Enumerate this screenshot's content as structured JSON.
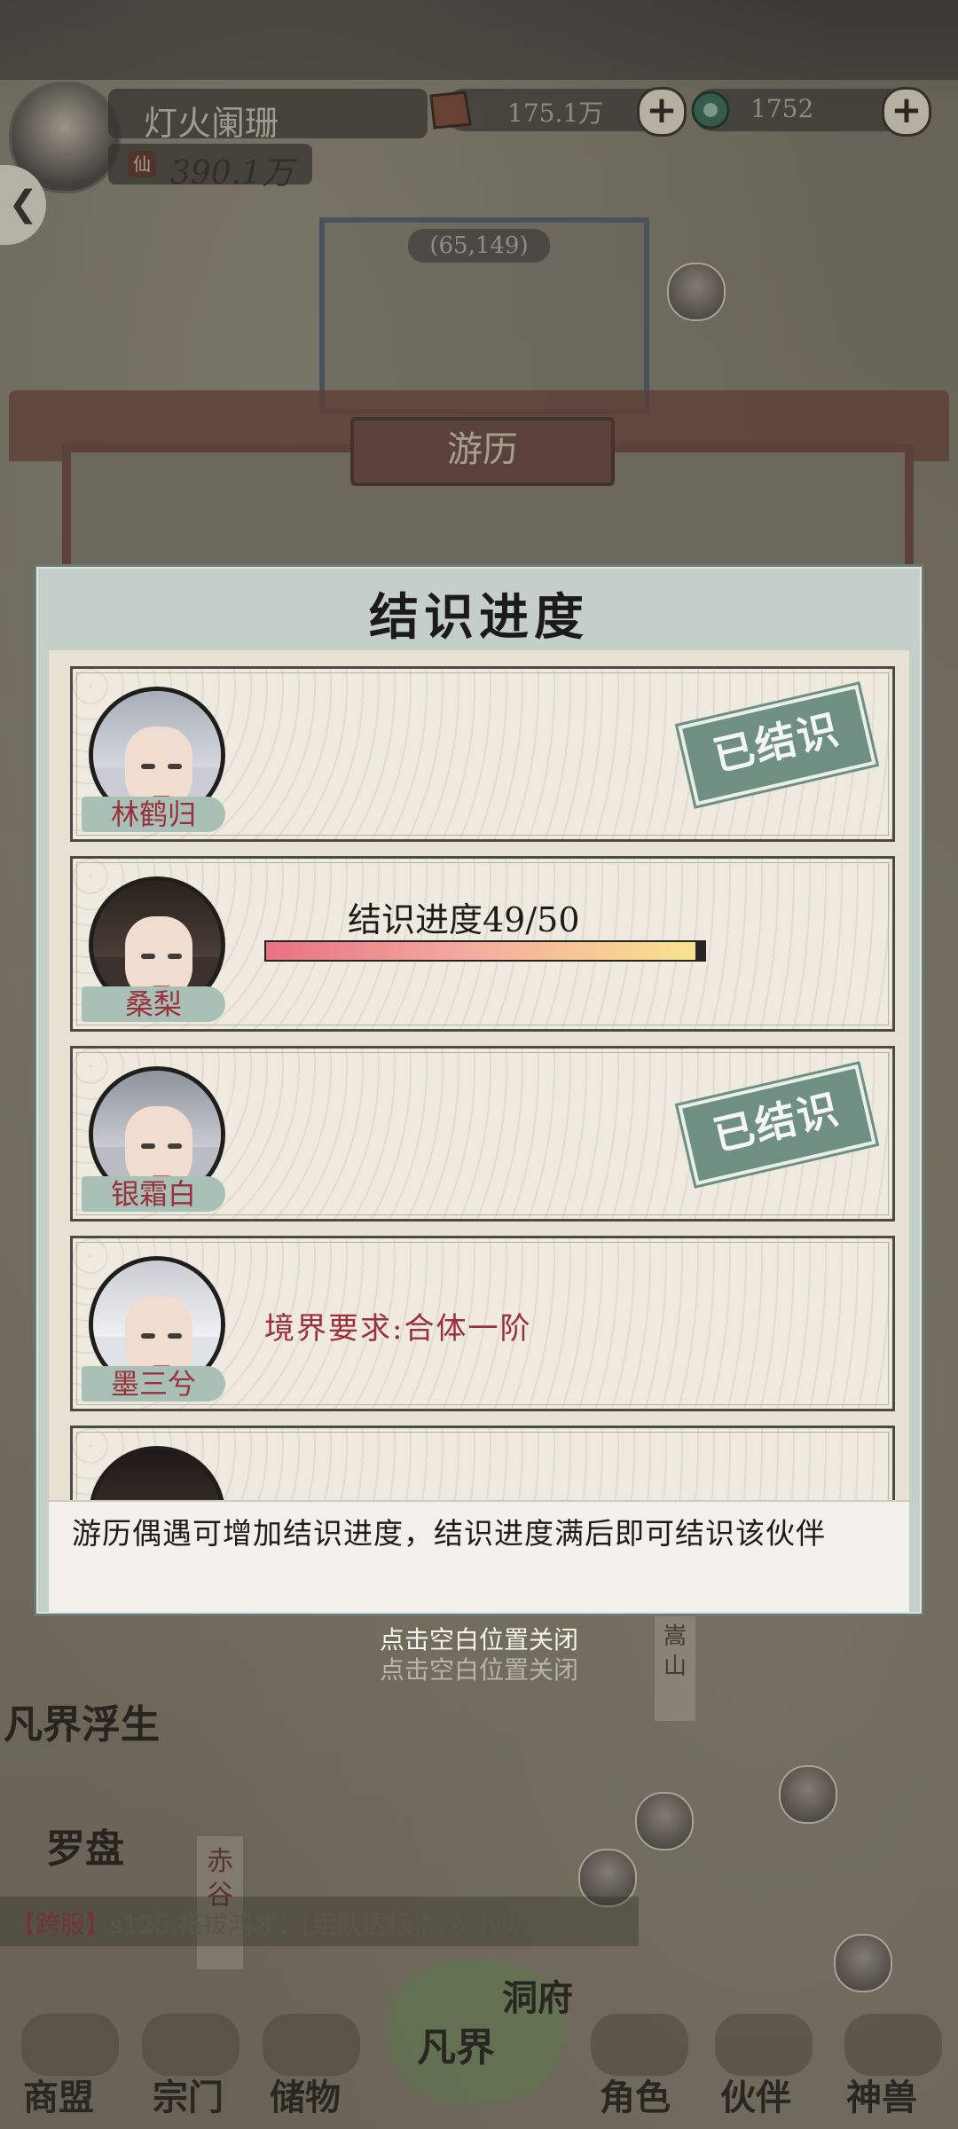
{
  "player": {
    "name": "灯火阑珊",
    "power": "390.1万"
  },
  "currencies": [
    {
      "icon": "ore-icon",
      "value": "175.1万"
    },
    {
      "icon": "jade-icon",
      "value": "1752"
    }
  ],
  "map": {
    "coordinate": "(65,149)"
  },
  "scene": {
    "plaque": "游历",
    "songshan": "嵩山",
    "chigu": "赤谷"
  },
  "modal": {
    "title": "结识进度",
    "companions": [
      {
        "name": "林鹤归",
        "status": "known",
        "stamp": "已结识"
      },
      {
        "name": "桑梨",
        "status": "progress",
        "progress_label": "结识进度49/50",
        "progress_current": 49,
        "progress_max": 50
      },
      {
        "name": "银霜白",
        "status": "known",
        "stamp": "已结识"
      },
      {
        "name": "墨三兮",
        "status": "locked",
        "requirement": "境界要求:合体一阶"
      }
    ],
    "note": "游历偶遇可增加结识进度，结识进度满后即可结识该伙伴",
    "close_hint": "点击空白位置关闭"
  },
  "left_features": {
    "rebirth": "凡界浮生",
    "compass": "罗盘"
  },
  "chat": {
    "tag": "【跨服】",
    "message": "s125.拓拔鸿才：[组队达标]加入小队"
  },
  "bottom_nav": {
    "items": [
      "商盟",
      "宗门",
      "储物",
      "角色",
      "伙伴",
      "神兽"
    ],
    "center": "凡界",
    "center_secondary": "洞府"
  },
  "colors": {
    "accent_red": "#9b2f3c",
    "stamp_green": "#6f8f81",
    "modal_bg": "#c3cfc8"
  }
}
